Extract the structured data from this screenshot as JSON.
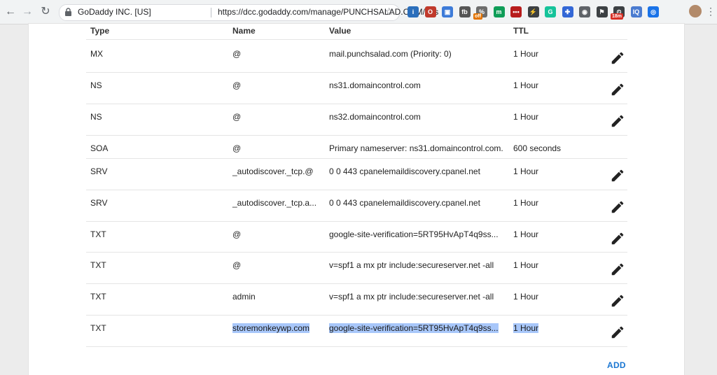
{
  "browser": {
    "site_identity": "GoDaddy INC. [US]",
    "url": "https://dcc.godaddy.com/manage/PUNCHSALAD.COM/dns",
    "extensions": [
      {
        "icon": "onepassword-icon",
        "color": "#2a6ebb",
        "glyph": "i"
      },
      {
        "icon": "ublock-icon",
        "color": "#c0392b",
        "glyph": "O"
      },
      {
        "icon": "window-icon",
        "color": "#3d7bd8",
        "glyph": "▣"
      },
      {
        "icon": "facebook-box-icon",
        "color": "#555555",
        "glyph": "fb"
      },
      {
        "icon": "discount-icon",
        "color": "#6d6d6d",
        "glyph": "%"
      },
      {
        "icon": "m-icon",
        "color": "#0f9d58",
        "glyph": "m"
      },
      {
        "icon": "dots-icon",
        "color": "#b71c1c",
        "glyph": "•••"
      },
      {
        "icon": "lightning-icon",
        "color": "#3c4043",
        "glyph": "⚡"
      },
      {
        "icon": "grammarly-icon",
        "color": "#15c39a",
        "glyph": "G"
      },
      {
        "icon": "puzzle-icon",
        "color": "#3367d6",
        "glyph": "✚"
      },
      {
        "icon": "camera-icon",
        "color": "#5f6368",
        "glyph": "◉"
      },
      {
        "icon": "flag-icon",
        "color": "#3c4043",
        "glyph": "⚑"
      },
      {
        "icon": "timer-icon",
        "color": "#3c4043",
        "glyph": "⏲"
      },
      {
        "icon": "iq-icon",
        "color": "#4a7bd0",
        "glyph": "IQ"
      },
      {
        "icon": "eye-icon",
        "color": "#1a73e8",
        "glyph": "◎"
      }
    ],
    "ext_badge_off": "off",
    "ext_badge_time": "18m"
  },
  "table": {
    "headers": {
      "type": "Type",
      "name": "Name",
      "value": "Value",
      "ttl": "TTL"
    },
    "rows": [
      {
        "type": "MX",
        "name": "@",
        "value": "mail.punchsalad.com (Priority: 0)",
        "ttl": "1 Hour",
        "editable": true
      },
      {
        "type": "NS",
        "name": "@",
        "value": "ns31.domaincontrol.com",
        "ttl": "1 Hour",
        "editable": true
      },
      {
        "type": "NS",
        "name": "@",
        "value": "ns32.domaincontrol.com",
        "ttl": "1 Hour",
        "editable": true
      },
      {
        "type": "SOA",
        "name": "@",
        "value": "Primary nameserver: ns31.domaincontrol.com.",
        "ttl": "600 seconds",
        "editable": false
      },
      {
        "type": "SRV",
        "name": "_autodiscover._tcp.@",
        "value": "0 0 443 cpanelemaildiscovery.cpanel.net",
        "ttl": "1 Hour",
        "editable": true
      },
      {
        "type": "SRV",
        "name": "_autodiscover._tcp.a...",
        "value": "0 0 443 cpanelemaildiscovery.cpanel.net",
        "ttl": "1 Hour",
        "editable": true
      },
      {
        "type": "TXT",
        "name": "@",
        "value": "google-site-verification=5RT95HvApT4q9ss...",
        "ttl": "1 Hour",
        "editable": true
      },
      {
        "type": "TXT",
        "name": "@",
        "value": "v=spf1 a mx ptr include:secureserver.net -all",
        "ttl": "1 Hour",
        "editable": true
      },
      {
        "type": "TXT",
        "name": "admin",
        "value": "v=spf1 a mx ptr include:secureserver.net -all",
        "ttl": "1 Hour",
        "editable": true
      },
      {
        "type": "TXT",
        "name": "storemonkeywp.com",
        "value": "google-site-verification=5RT95HvApT4q9ss...",
        "ttl": "1 Hour",
        "editable": true,
        "selected": true
      }
    ]
  },
  "add_label": "ADD"
}
